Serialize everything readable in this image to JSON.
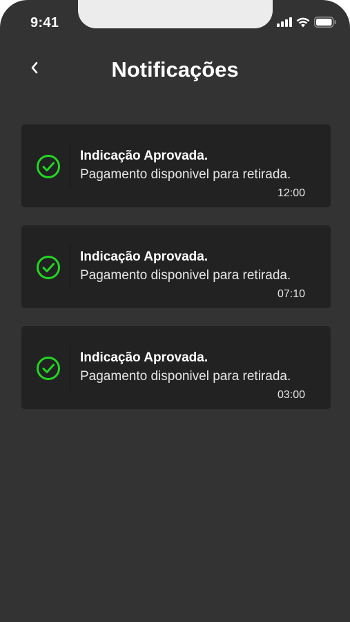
{
  "status_bar": {
    "time": "9:41",
    "icons": [
      "signal-icon",
      "wifi-icon",
      "battery-icon"
    ]
  },
  "header": {
    "back_icon": "chevron-left-icon",
    "title": "Notificações"
  },
  "notifications": [
    {
      "icon": "check-circle-icon",
      "title": "Indicação Aprovada.",
      "message": "Pagamento disponivel para retirada.",
      "time": "12:00"
    },
    {
      "icon": "check-circle-icon",
      "title": "Indicação Aprovada.",
      "message": "Pagamento disponivel para retirada.",
      "time": "07:10"
    },
    {
      "icon": "check-circle-icon",
      "title": "Indicação Aprovada.",
      "message": "Pagamento disponivel para retirada.",
      "time": "03:00"
    }
  ],
  "colors": {
    "background": "#333333",
    "card": "#222222",
    "accent": "#22d622",
    "text": "#ffffff"
  }
}
